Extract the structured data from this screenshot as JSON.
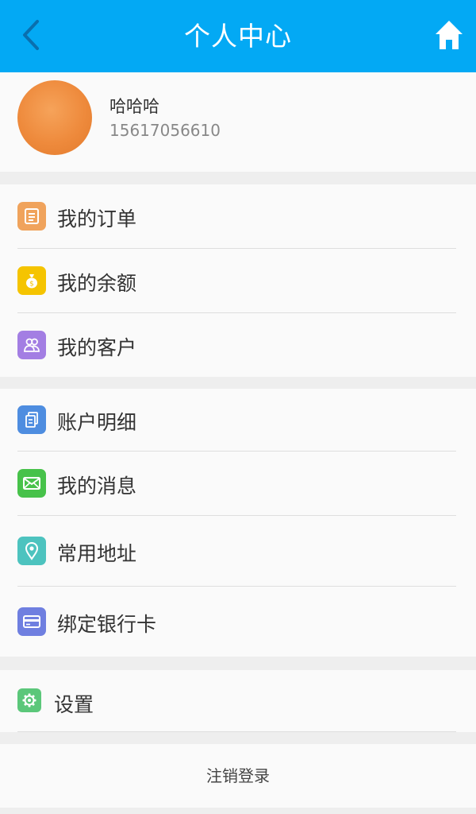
{
  "header": {
    "title": "个人中心",
    "back_icon": "chevron-left-icon",
    "home_icon": "home-icon",
    "color": "#03a9f4"
  },
  "profile": {
    "name": "哈哈哈",
    "phone": "15617056610"
  },
  "menu": {
    "orders": {
      "label": "我的订单",
      "icon": "clipboard-icon",
      "color": "#f0a35c"
    },
    "balance": {
      "label": "我的余额",
      "icon": "money-bag-icon",
      "color": "#f5c400"
    },
    "customers": {
      "label": "我的客户",
      "icon": "users-icon",
      "color": "#a37ee3"
    },
    "account_details": {
      "label": "账户明细",
      "icon": "document-icon",
      "color": "#4e8de0"
    },
    "messages": {
      "label": "我的消息",
      "icon": "mail-icon",
      "color": "#47c24a"
    },
    "addresses": {
      "label": "常用地址",
      "icon": "location-pin-icon",
      "color": "#4dc3bf"
    },
    "bank_card": {
      "label": "绑定银行卡",
      "icon": "credit-card-icon",
      "color": "#6f7fe0"
    },
    "settings": {
      "label": "设置",
      "icon": "gear-icon",
      "color": "#5bc77a"
    }
  },
  "logout": {
    "label": "注销登录"
  }
}
